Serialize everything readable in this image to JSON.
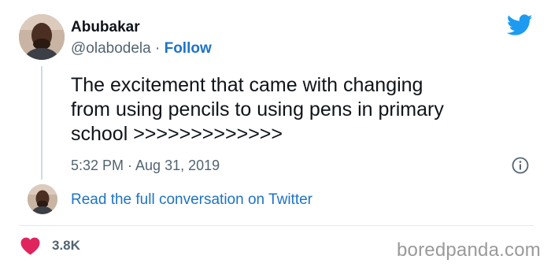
{
  "tweet": {
    "author_name": "Abubakar",
    "author_handle": "@olabodela",
    "separator": " · ",
    "follow_label": "Follow",
    "text": "The excitement that came with changing\nfrom using pencils to using pens in primary\nschool >>>>>>>>>>>>>",
    "timestamp": "5:32 PM · Aug 31, 2019",
    "read_conversation_label": "Read the full conversation on Twitter",
    "like_count": "3.8K"
  },
  "icons": {
    "brand": "twitter-bird-icon",
    "info": "info-icon",
    "like": "heart-icon"
  },
  "colors": {
    "link": "#1d73c6",
    "twitter_brand": "#1d9bf0",
    "heart": "#e0245e",
    "secondary_text": "#536471"
  },
  "watermark": "boredpanda.com"
}
